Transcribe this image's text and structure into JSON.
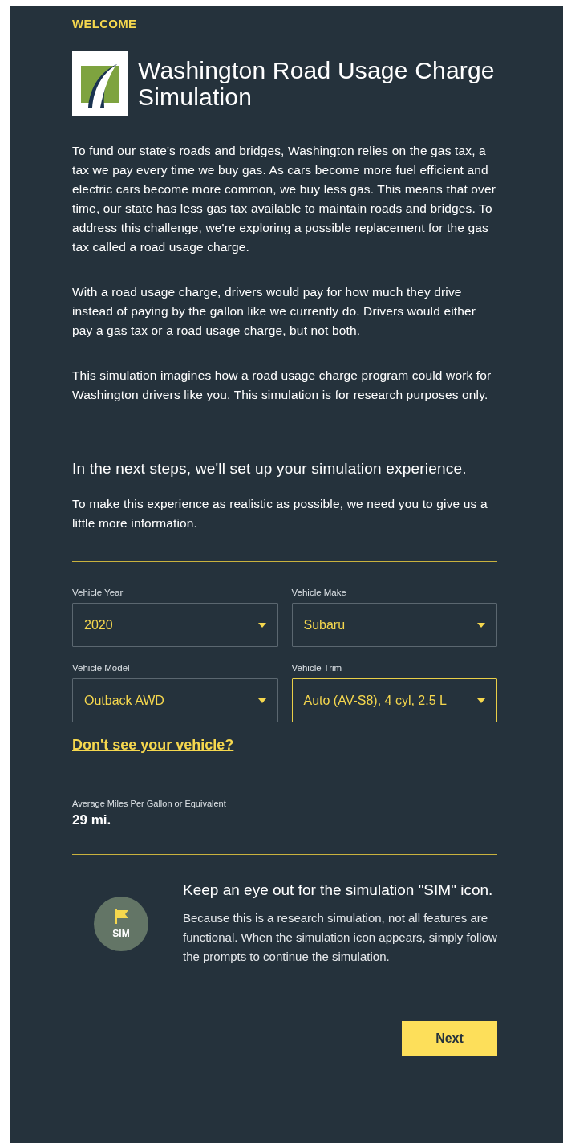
{
  "eyebrow": "WELCOME",
  "title": "Washington Road Usage Charge Simulation",
  "intro": [
    "To fund our state's roads and bridges, Washington relies on the gas tax, a tax we pay every time we buy gas. As cars become more fuel efficient and electric cars become more common, we buy less gas. This means that over time, our state has less gas tax available to maintain roads and bridges. To address this challenge, we're exploring a possible replacement for the gas tax called a road usage charge.",
    "With a road usage charge, drivers would pay for how much they drive instead of paying by the gallon like we currently do. Drivers would either pay a gas tax or a road usage charge, but not both.",
    "This simulation imagines how a road usage charge program could work for Washington drivers like you. This simulation is for research purposes only."
  ],
  "setup": {
    "heading": "In the next steps, we'll set up your simulation experience.",
    "text": "To make this experience as realistic as possible, we need you to give us a little more information."
  },
  "vehicle_fields": [
    {
      "label": "Vehicle Year",
      "value": "2020",
      "focused": false
    },
    {
      "label": "Vehicle Make",
      "value": "Subaru",
      "focused": false
    },
    {
      "label": "Vehicle Model",
      "value": "Outback AWD",
      "focused": false
    },
    {
      "label": "Vehicle Trim",
      "value": "Auto (AV-S8), 4 cyl, 2.5 L",
      "focused": true
    }
  ],
  "missing_vehicle_link": "Don't see your vehicle?",
  "mpg": {
    "label": "Average Miles Per Gallon or Equivalent",
    "value": "29 mi."
  },
  "sim_notice": {
    "badge": "SIM",
    "heading": "Keep an eye out for the simulation \"SIM\" icon.",
    "text": "Because this is a research simulation, not all features are functional. When the simulation icon appears, simply follow the prompts to continue the simulation."
  },
  "next_button": "Next"
}
